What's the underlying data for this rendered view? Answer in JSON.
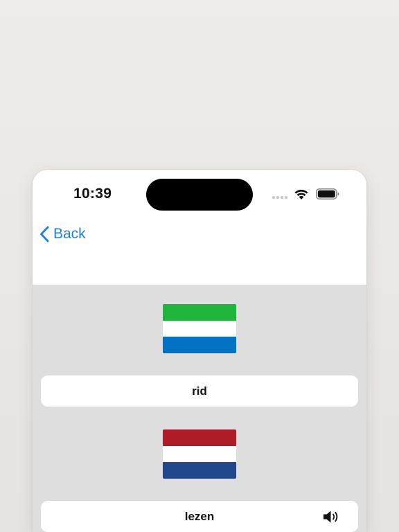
{
  "status_bar": {
    "time": "10:39"
  },
  "nav": {
    "back_label": "Back",
    "accent_color": "#1a7ff0"
  },
  "questions": [
    {
      "flag": "Sierra Leone",
      "flag_colors": [
        "#1eb53a",
        "#ffffff",
        "#0072c6"
      ],
      "answer": "rid",
      "has_audio": false
    },
    {
      "flag": "Netherlands",
      "flag_colors": [
        "#ae1c28",
        "#ffffff",
        "#21468b"
      ],
      "answer": "lezen",
      "has_audio": true
    }
  ],
  "icons": {
    "back": "chevron-left-icon",
    "wifi": "wifi-icon",
    "battery": "battery-icon",
    "signal": "cellular-signal-icon",
    "audio": "speaker-icon"
  }
}
